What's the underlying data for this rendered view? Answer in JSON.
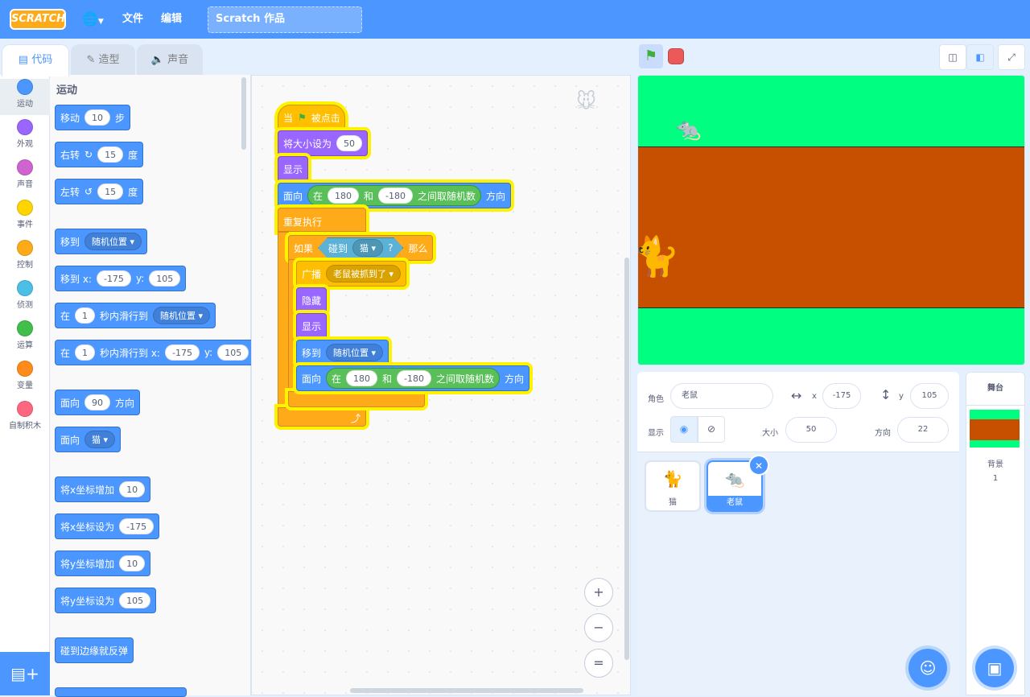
{
  "menubar": {
    "logo": "SCRATCH",
    "globe_icon": "globe-icon",
    "file": "文件",
    "edit": "编辑",
    "project_title": "Scratch 作品"
  },
  "tabs": {
    "code": "代码",
    "costumes": "造型",
    "sounds": "声音"
  },
  "categories": [
    {
      "label": "运动",
      "color": "#4c97ff"
    },
    {
      "label": "外观",
      "color": "#9966ff"
    },
    {
      "label": "声音",
      "color": "#cf63cf"
    },
    {
      "label": "事件",
      "color": "#ffd500"
    },
    {
      "label": "控制",
      "color": "#ffab19"
    },
    {
      "label": "侦测",
      "color": "#4cbfe6"
    },
    {
      "label": "运算",
      "color": "#40bf4a"
    },
    {
      "label": "变量",
      "color": "#ff8c1a"
    },
    {
      "label": "自制积木",
      "color": "#ff6680"
    }
  ],
  "palette": {
    "title": "运动",
    "move": {
      "label": "移动",
      "val": "10",
      "suffix": "步"
    },
    "turn_right": {
      "label": "右转",
      "val": "15",
      "suffix": "度"
    },
    "turn_left": {
      "label": "左转",
      "val": "15",
      "suffix": "度"
    },
    "goto": {
      "label": "移到",
      "drop": "随机位置"
    },
    "goto_xy": {
      "label": "移到 x:",
      "x": "-175",
      "ylabel": "y:",
      "y": "105"
    },
    "glide": {
      "label": "在",
      "secs": "1",
      "mid": "秒内滑行到",
      "drop": "随机位置"
    },
    "glide_xy": {
      "label": "在",
      "secs": "1",
      "mid": "秒内滑行到 x:",
      "x": "-175",
      "ylabel": "y:",
      "y": "105"
    },
    "point_dir": {
      "label": "面向",
      "val": "90",
      "suffix": "方向"
    },
    "point_towards": {
      "label": "面向",
      "drop": "猫"
    },
    "change_x": {
      "label": "将x坐标增加",
      "val": "10"
    },
    "set_x": {
      "label": "将x坐标设为",
      "val": "-175"
    },
    "change_y": {
      "label": "将y坐标增加",
      "val": "10"
    },
    "set_y": {
      "label": "将y坐标设为",
      "val": "105"
    },
    "bounce": {
      "label": "碰到边缘就反弹"
    }
  },
  "script": {
    "hat": {
      "prefix": "当",
      "suffix": "被点击"
    },
    "set_size": {
      "label": "将大小设为",
      "val": "50"
    },
    "show1": "显示",
    "point_random": {
      "label": "面向",
      "in": "在",
      "a": "180",
      "and": "和",
      "b": "-180",
      "pick": "之间取随机数",
      "dir": "方向"
    },
    "forever": "重复执行",
    "if": {
      "label": "如果",
      "touch": "碰到",
      "target": "猫",
      "q": "?",
      "then": "那么"
    },
    "broadcast": {
      "label": "广播",
      "msg": "老鼠被抓到了"
    },
    "hide": "隐藏",
    "show2": "显示",
    "goto": {
      "label": "移到",
      "drop": "随机位置"
    },
    "point_random2": {
      "label": "面向",
      "in": "在",
      "a": "180",
      "and": "和",
      "b": "-180",
      "pick": "之间取随机数",
      "dir": "方向"
    }
  },
  "zoom": {
    "in": "+",
    "out": "−",
    "reset": "="
  },
  "sprite_info": {
    "sprite_label": "角色",
    "sprite_name": "老鼠",
    "x_label": "x",
    "x": "-175",
    "y_label": "y",
    "y": "105",
    "show_label": "显示",
    "size_label": "大小",
    "size": "50",
    "direction_label": "方向",
    "direction": "22"
  },
  "sprites": [
    {
      "name": "猫",
      "selected": false
    },
    {
      "name": "老鼠",
      "selected": true
    }
  ],
  "stage_pane": {
    "title": "舞台",
    "backdrops_label": "背景",
    "backdrops_count": "1"
  },
  "colors": {
    "accent": "#4c97ff",
    "stage_green": "#00ff80",
    "stage_ground": "#c64f00"
  }
}
